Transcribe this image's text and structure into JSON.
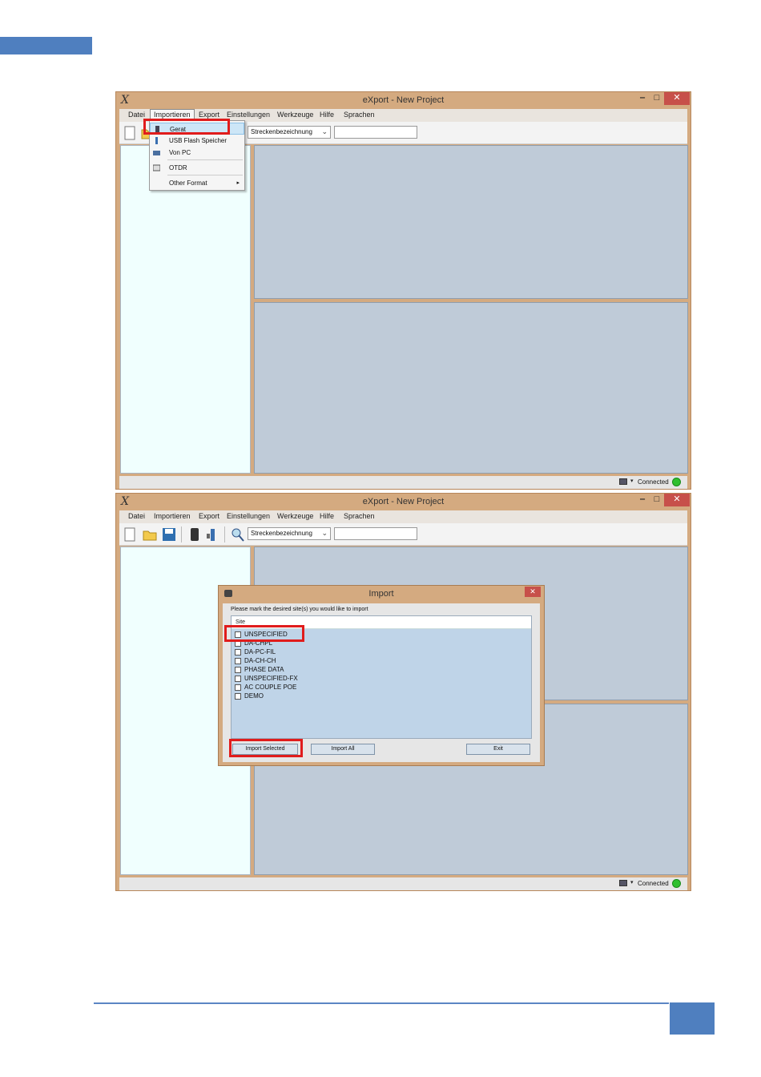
{
  "window1": {
    "title": "eXport - New Project",
    "app_icon": "X",
    "menu": [
      "Datei",
      "Importieren",
      "Export",
      "Einstellungen",
      "Werkzeuge",
      "Hilfe",
      "Sprachen"
    ],
    "combo_value": "Streckenbezeichnung",
    "status_text": "Connected",
    "import_menu": {
      "items": [
        {
          "label": "Gerat",
          "icon": "device-icon"
        },
        {
          "label": "USB Flash Speicher",
          "icon": "usb-icon"
        },
        {
          "label": "Von PC",
          "icon": "pc-icon"
        },
        {
          "label": "OTDR",
          "icon": "otdr-icon"
        },
        {
          "label": "Other Format",
          "icon": "submenu-arrow"
        }
      ]
    }
  },
  "window2": {
    "title": "eXport - New Project",
    "app_icon": "X",
    "menu": [
      "Datei",
      "Importieren",
      "Export",
      "Einstellungen",
      "Werkzeuge",
      "Hilfe",
      "Sprachen"
    ],
    "combo_value": "Streckenbezeichnung",
    "status_text": "Connected",
    "dialog": {
      "title": "Import",
      "prompt": "Please mark the desired site(s) you would like to import",
      "column_header": "Site",
      "sites": [
        "UNSPECIFIED",
        "DA-CHPL",
        "DA-PC-FIL",
        "DA-CH-CH",
        "PHASE DATA",
        "UNSPECIFIED-FX",
        "AC COUPLE POE",
        "DEMO"
      ],
      "buttons": {
        "import_selected": "Import Selected",
        "import_all": "Import All",
        "exit": "Exit"
      }
    }
  },
  "colors": {
    "frame": "#d4aa80",
    "pane": "#bfcbd8",
    "highlight": "#e01c1c",
    "accent": "#4f7fbf"
  }
}
